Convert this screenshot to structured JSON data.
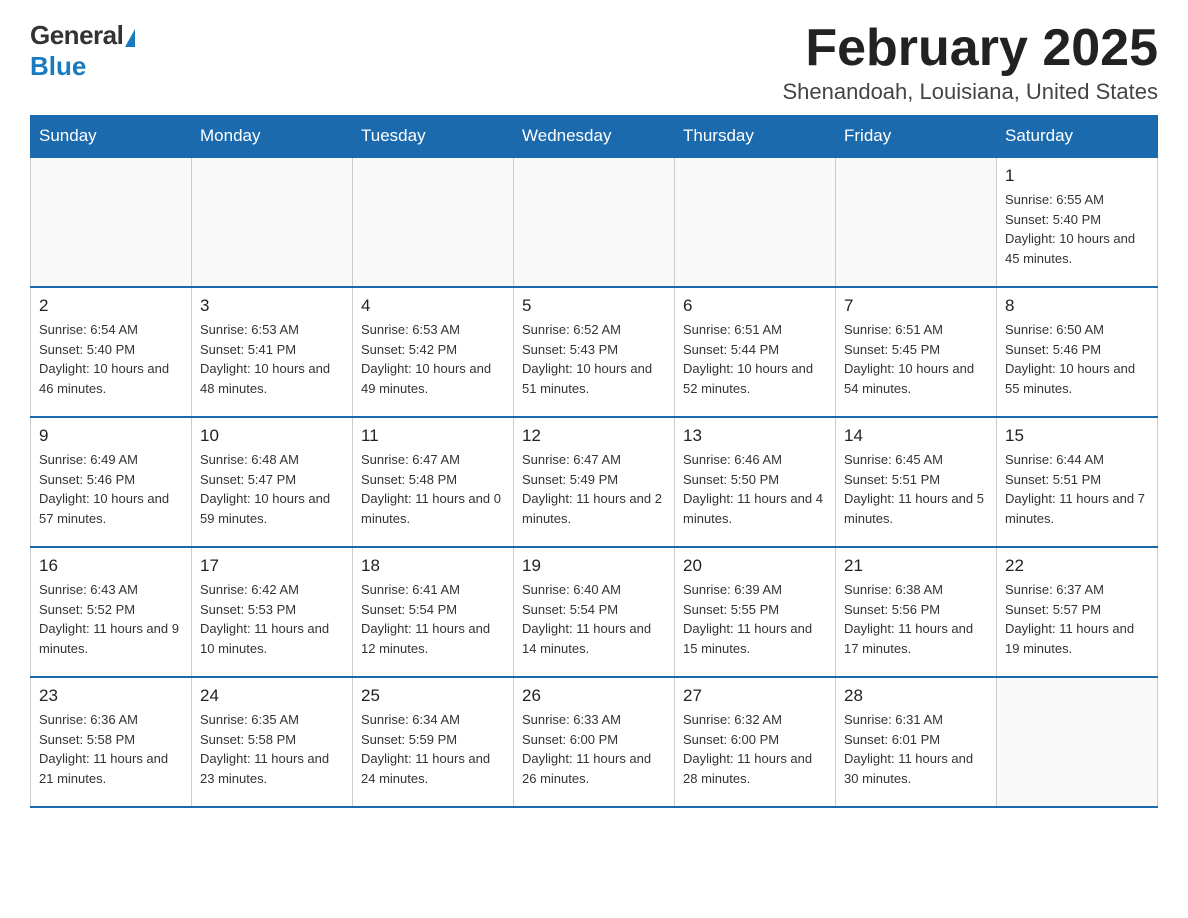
{
  "header": {
    "logo_general": "General",
    "logo_blue": "Blue",
    "month_title": "February 2025",
    "location": "Shenandoah, Louisiana, United States"
  },
  "weekdays": [
    "Sunday",
    "Monday",
    "Tuesday",
    "Wednesday",
    "Thursday",
    "Friday",
    "Saturday"
  ],
  "weeks": [
    [
      {
        "day": "",
        "sunrise": "",
        "sunset": "",
        "daylight": ""
      },
      {
        "day": "",
        "sunrise": "",
        "sunset": "",
        "daylight": ""
      },
      {
        "day": "",
        "sunrise": "",
        "sunset": "",
        "daylight": ""
      },
      {
        "day": "",
        "sunrise": "",
        "sunset": "",
        "daylight": ""
      },
      {
        "day": "",
        "sunrise": "",
        "sunset": "",
        "daylight": ""
      },
      {
        "day": "",
        "sunrise": "",
        "sunset": "",
        "daylight": ""
      },
      {
        "day": "1",
        "sunrise": "Sunrise: 6:55 AM",
        "sunset": "Sunset: 5:40 PM",
        "daylight": "Daylight: 10 hours and 45 minutes."
      }
    ],
    [
      {
        "day": "2",
        "sunrise": "Sunrise: 6:54 AM",
        "sunset": "Sunset: 5:40 PM",
        "daylight": "Daylight: 10 hours and 46 minutes."
      },
      {
        "day": "3",
        "sunrise": "Sunrise: 6:53 AM",
        "sunset": "Sunset: 5:41 PM",
        "daylight": "Daylight: 10 hours and 48 minutes."
      },
      {
        "day": "4",
        "sunrise": "Sunrise: 6:53 AM",
        "sunset": "Sunset: 5:42 PM",
        "daylight": "Daylight: 10 hours and 49 minutes."
      },
      {
        "day": "5",
        "sunrise": "Sunrise: 6:52 AM",
        "sunset": "Sunset: 5:43 PM",
        "daylight": "Daylight: 10 hours and 51 minutes."
      },
      {
        "day": "6",
        "sunrise": "Sunrise: 6:51 AM",
        "sunset": "Sunset: 5:44 PM",
        "daylight": "Daylight: 10 hours and 52 minutes."
      },
      {
        "day": "7",
        "sunrise": "Sunrise: 6:51 AM",
        "sunset": "Sunset: 5:45 PM",
        "daylight": "Daylight: 10 hours and 54 minutes."
      },
      {
        "day": "8",
        "sunrise": "Sunrise: 6:50 AM",
        "sunset": "Sunset: 5:46 PM",
        "daylight": "Daylight: 10 hours and 55 minutes."
      }
    ],
    [
      {
        "day": "9",
        "sunrise": "Sunrise: 6:49 AM",
        "sunset": "Sunset: 5:46 PM",
        "daylight": "Daylight: 10 hours and 57 minutes."
      },
      {
        "day": "10",
        "sunrise": "Sunrise: 6:48 AM",
        "sunset": "Sunset: 5:47 PM",
        "daylight": "Daylight: 10 hours and 59 minutes."
      },
      {
        "day": "11",
        "sunrise": "Sunrise: 6:47 AM",
        "sunset": "Sunset: 5:48 PM",
        "daylight": "Daylight: 11 hours and 0 minutes."
      },
      {
        "day": "12",
        "sunrise": "Sunrise: 6:47 AM",
        "sunset": "Sunset: 5:49 PM",
        "daylight": "Daylight: 11 hours and 2 minutes."
      },
      {
        "day": "13",
        "sunrise": "Sunrise: 6:46 AM",
        "sunset": "Sunset: 5:50 PM",
        "daylight": "Daylight: 11 hours and 4 minutes."
      },
      {
        "day": "14",
        "sunrise": "Sunrise: 6:45 AM",
        "sunset": "Sunset: 5:51 PM",
        "daylight": "Daylight: 11 hours and 5 minutes."
      },
      {
        "day": "15",
        "sunrise": "Sunrise: 6:44 AM",
        "sunset": "Sunset: 5:51 PM",
        "daylight": "Daylight: 11 hours and 7 minutes."
      }
    ],
    [
      {
        "day": "16",
        "sunrise": "Sunrise: 6:43 AM",
        "sunset": "Sunset: 5:52 PM",
        "daylight": "Daylight: 11 hours and 9 minutes."
      },
      {
        "day": "17",
        "sunrise": "Sunrise: 6:42 AM",
        "sunset": "Sunset: 5:53 PM",
        "daylight": "Daylight: 11 hours and 10 minutes."
      },
      {
        "day": "18",
        "sunrise": "Sunrise: 6:41 AM",
        "sunset": "Sunset: 5:54 PM",
        "daylight": "Daylight: 11 hours and 12 minutes."
      },
      {
        "day": "19",
        "sunrise": "Sunrise: 6:40 AM",
        "sunset": "Sunset: 5:54 PM",
        "daylight": "Daylight: 11 hours and 14 minutes."
      },
      {
        "day": "20",
        "sunrise": "Sunrise: 6:39 AM",
        "sunset": "Sunset: 5:55 PM",
        "daylight": "Daylight: 11 hours and 15 minutes."
      },
      {
        "day": "21",
        "sunrise": "Sunrise: 6:38 AM",
        "sunset": "Sunset: 5:56 PM",
        "daylight": "Daylight: 11 hours and 17 minutes."
      },
      {
        "day": "22",
        "sunrise": "Sunrise: 6:37 AM",
        "sunset": "Sunset: 5:57 PM",
        "daylight": "Daylight: 11 hours and 19 minutes."
      }
    ],
    [
      {
        "day": "23",
        "sunrise": "Sunrise: 6:36 AM",
        "sunset": "Sunset: 5:58 PM",
        "daylight": "Daylight: 11 hours and 21 minutes."
      },
      {
        "day": "24",
        "sunrise": "Sunrise: 6:35 AM",
        "sunset": "Sunset: 5:58 PM",
        "daylight": "Daylight: 11 hours and 23 minutes."
      },
      {
        "day": "25",
        "sunrise": "Sunrise: 6:34 AM",
        "sunset": "Sunset: 5:59 PM",
        "daylight": "Daylight: 11 hours and 24 minutes."
      },
      {
        "day": "26",
        "sunrise": "Sunrise: 6:33 AM",
        "sunset": "Sunset: 6:00 PM",
        "daylight": "Daylight: 11 hours and 26 minutes."
      },
      {
        "day": "27",
        "sunrise": "Sunrise: 6:32 AM",
        "sunset": "Sunset: 6:00 PM",
        "daylight": "Daylight: 11 hours and 28 minutes."
      },
      {
        "day": "28",
        "sunrise": "Sunrise: 6:31 AM",
        "sunset": "Sunset: 6:01 PM",
        "daylight": "Daylight: 11 hours and 30 minutes."
      },
      {
        "day": "",
        "sunrise": "",
        "sunset": "",
        "daylight": ""
      }
    ]
  ]
}
